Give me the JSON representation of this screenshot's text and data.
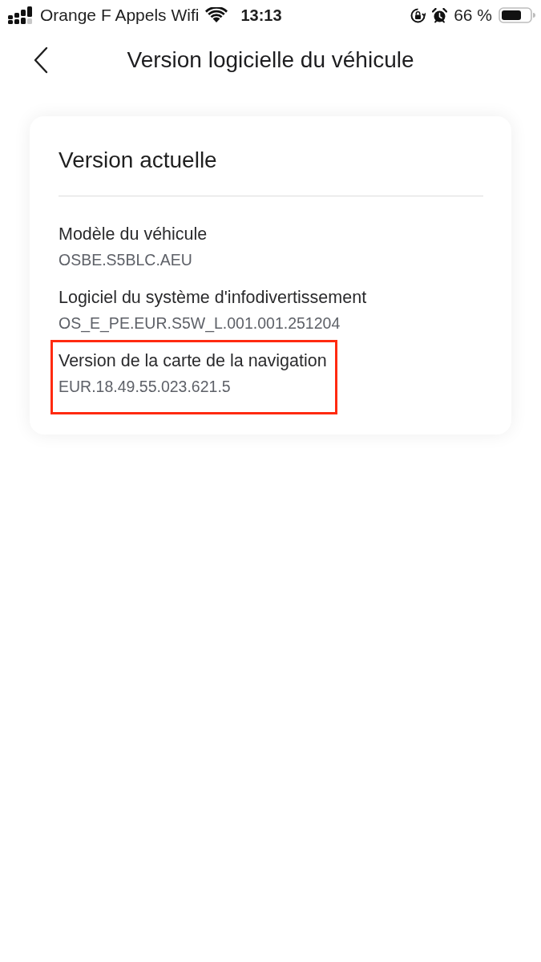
{
  "status_bar": {
    "carrier": "Orange F Appels Wifi",
    "time": "13:13",
    "battery_percent": "66 %"
  },
  "header": {
    "title": "Version logicielle du véhicule"
  },
  "card": {
    "title": "Version actuelle",
    "items": [
      {
        "label": "Modèle du véhicule",
        "value": "OSBE.S5BLC.AEU",
        "highlighted": false
      },
      {
        "label": "Logiciel du système d'infodivertissement",
        "value": "OS_E_PE.EUR.S5W_L.001.001.251204",
        "highlighted": false
      },
      {
        "label": "Version de la carte de la navigation",
        "value": "EUR.18.49.55.023.621.5",
        "highlighted": true
      }
    ]
  }
}
